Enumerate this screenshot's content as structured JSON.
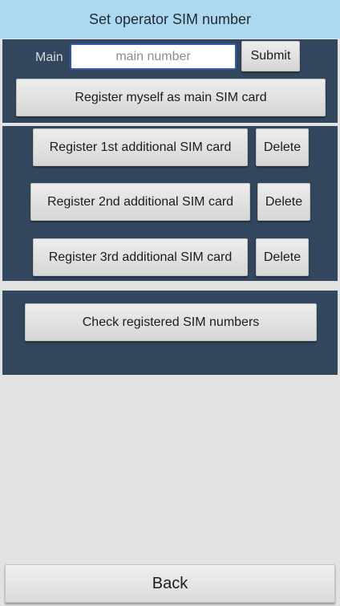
{
  "header": {
    "title": "Set operator SIM number"
  },
  "main_section": {
    "label": "Main",
    "input_placeholder": "main number",
    "input_value": "",
    "submit_label": "Submit",
    "register_main_label": "Register myself as main SIM card"
  },
  "additional_section": {
    "rows": [
      {
        "register_label": "Register 1st additional SIM card",
        "delete_label": "Delete"
      },
      {
        "register_label": "Register 2nd additional SIM card",
        "delete_label": "Delete"
      },
      {
        "register_label": "Register 3rd additional SIM card",
        "delete_label": "Delete"
      }
    ]
  },
  "check_section": {
    "check_label": "Check registered SIM numbers"
  },
  "footer": {
    "back_label": "Back"
  },
  "colors": {
    "title_bar_bg": "#aed8ef",
    "panel_bg": "#32475d",
    "screen_bg": "#e2e2e2",
    "input_border": "#3358b6"
  }
}
